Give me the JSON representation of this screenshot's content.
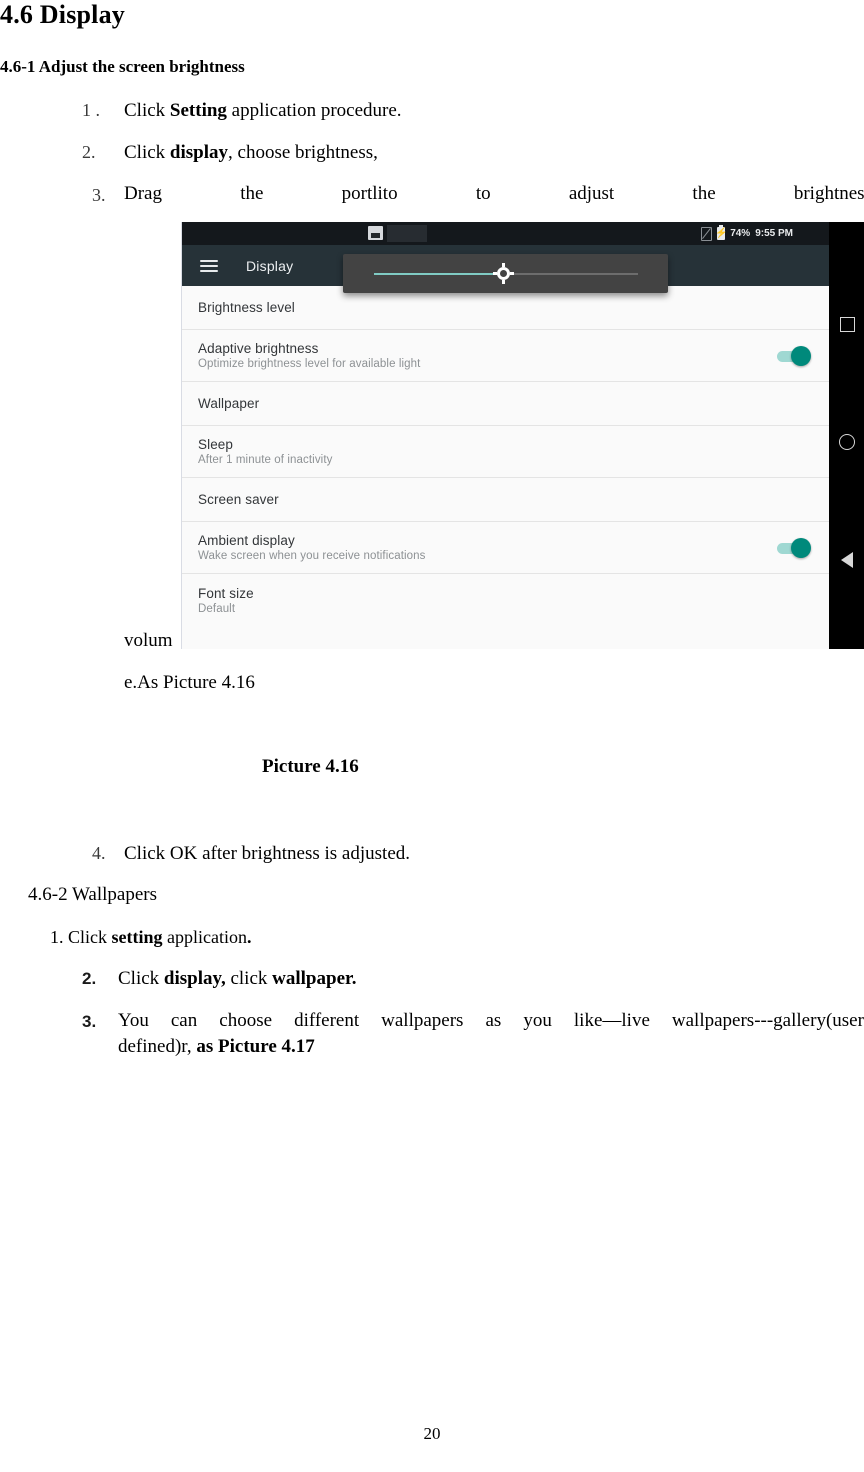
{
  "document": {
    "heading": "4.6 Display",
    "subheading": "4.6-1 Adjust the screen brightness",
    "steps": [
      {
        "num": "1 .",
        "prefix": "Click ",
        "bold": "Setting",
        "suffix": " application procedure."
      },
      {
        "num": "2.",
        "prefix": "Click ",
        "bold": "display",
        "suffix": ", choose brightness,"
      }
    ],
    "step3": {
      "num": "3.",
      "words": [
        "Drag",
        "the",
        "portlito",
        "to",
        "adjust",
        "the",
        "brightness"
      ],
      "continuation_left": "volum",
      "continuation_next": "e.As Picture 4.16"
    },
    "figure_caption": "Picture 4.16",
    "step4": {
      "num": "4.",
      "text": "Click OK after brightness is adjusted."
    },
    "section2": {
      "heading": "4.6-2 Wallpapers",
      "item1": {
        "num": "1.",
        "prefix": "Click ",
        "bold": "setting",
        "suffix": " application",
        "tail_bold": "."
      },
      "item2": {
        "num": "2.",
        "prefix": "Click ",
        "bold1": "display,",
        "mid": " click ",
        "bold2": "wallpaper."
      },
      "item3": {
        "num": "3.",
        "line1_words": [
          "You",
          "can",
          "choose",
          "different",
          "wallpapers",
          "as",
          "you",
          "like—live",
          "wallpapers---gallery(user"
        ],
        "line2_plain": "defined)r, ",
        "line2_bold": "as Picture 4.17"
      }
    },
    "page_number": "20"
  },
  "screenshot": {
    "status_bar": {
      "notification_icon": "screenshot-image-icon",
      "no_sim_icon": "no-sim-icon",
      "battery_icon": "battery-charging-icon",
      "battery_percent": "74%",
      "time": "9:55 PM"
    },
    "toolbar": {
      "menu_icon": "hamburger-menu-icon",
      "title": "Display"
    },
    "brightness_popup": {
      "icon": "brightness-sun-icon",
      "value_percent": 44
    },
    "rows": [
      {
        "title": "Brightness level",
        "sub": null,
        "toggle": null
      },
      {
        "title": "Adaptive brightness",
        "sub": "Optimize brightness level for available light",
        "toggle": "on"
      },
      {
        "title": "Wallpaper",
        "sub": null,
        "toggle": null
      },
      {
        "title": "Sleep",
        "sub": "After 1 minute of inactivity",
        "toggle": null
      },
      {
        "title": "Screen saver",
        "sub": null,
        "toggle": null
      },
      {
        "title": "Ambient display",
        "sub": "Wake screen when you receive notifications",
        "toggle": "on"
      },
      {
        "title": "Font size",
        "sub": "Default",
        "toggle": null
      }
    ],
    "navbar": {
      "recents_icon": "square-recents-icon",
      "home_icon": "circle-home-icon",
      "back_icon": "triangle-back-icon"
    },
    "colors": {
      "statusbar": "#14181c",
      "toolbar": "#263238",
      "accent_toggle": "#00897b",
      "slider_fill": "#80cbc4",
      "popup_bg": "#434343"
    }
  }
}
